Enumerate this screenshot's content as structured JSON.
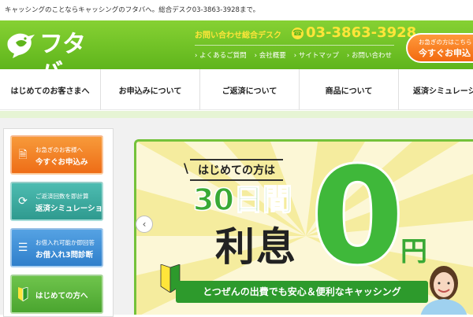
{
  "topline": "キャッシングのことならキャッシングのフタバへ。総合デスク03-3863-3928まで。",
  "header": {
    "logo_text": "フタバ",
    "contact_title": "お問い合わせ総合デスク",
    "phone": "03-3863-3928",
    "links": [
      "よくあるご質問",
      "会社概要",
      "サイトマップ",
      "お問い合わせ"
    ],
    "apply_small": "お急ぎの方はこちら",
    "apply_big": "今すぐお申込",
    "brand_color": "#5fb51c",
    "accent_color": "#ffe53a"
  },
  "nav": {
    "items": [
      "はじめてのお客さまへ",
      "お申込みについて",
      "ご返済について",
      "商品について",
      "返済シミュレーション"
    ]
  },
  "sidebar": {
    "buttons": [
      {
        "line1": "お急ぎのお客様へ",
        "line2": "今すぐお申込み",
        "icon": "document-icon",
        "color": "#f07a22"
      },
      {
        "line1": "ご返済回数を即計算",
        "line2": "返済シミュレーション",
        "icon": "refresh-icon",
        "color": "#3aa99f"
      },
      {
        "line1": "お借入れ可能か即回答",
        "line2": "お借入れ3問診断",
        "icon": "checklist-icon",
        "color": "#3d8fd6"
      },
      {
        "line1": "",
        "line2": "はじめての方へ",
        "icon": "wakaba-icon",
        "color": "#5cb53a"
      }
    ]
  },
  "banner": {
    "tag": "はじめての方は",
    "days": "30日間",
    "interest": "利息",
    "zero": "0",
    "yen": "円",
    "ribbon": "とつぜんの出費でも安心＆便利なキャッシング"
  }
}
